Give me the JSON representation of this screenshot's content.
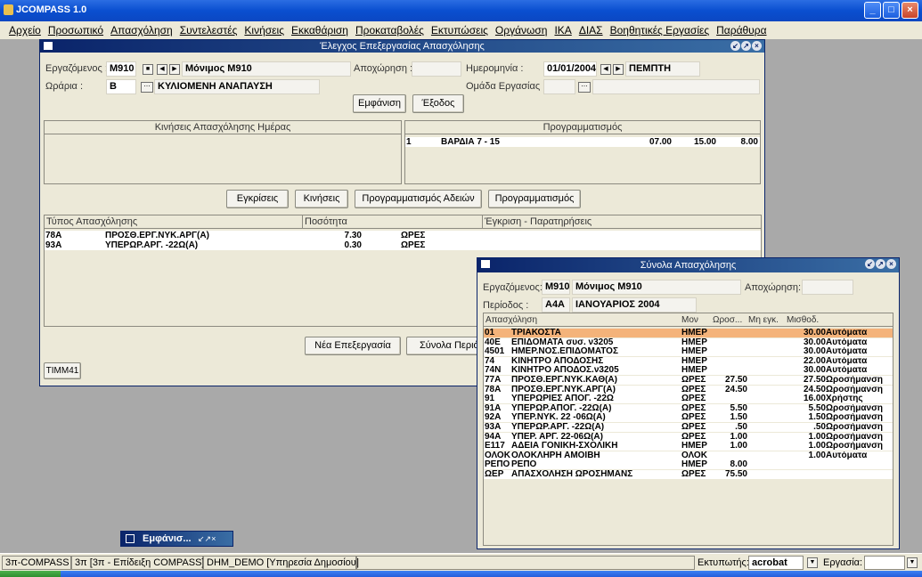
{
  "app": {
    "title": "JCOMPASS 1.0"
  },
  "window_controls": {
    "minimize": "_",
    "maximize": "□",
    "close": "×"
  },
  "menu": [
    "Αρχείο",
    "Προσωπικό",
    "Απασχόληση",
    "Συντελεστές",
    "Κινήσεις",
    "Εκκαθάριση",
    "Προκαταβολές",
    "Εκτυπώσεις",
    "Οργάνωση",
    "ΙΚΑ",
    "ΔΙΑΣ",
    "Βοηθητικές Εργασίες",
    "Παράθυρα"
  ],
  "main_window": {
    "title": "Έλεγχος Επεξεργασίας Απασχόλησης",
    "employee_label": "Εργαζόμενος :",
    "employee_code": "M910",
    "employee_name": "Μόνιμος Μ910",
    "leave_label": "Αποχώρηση :",
    "leave_value": "",
    "date_label": "Ημερομηνία :",
    "date_value": "01/01/2004",
    "day_name": "ΠΕΜΠΤΗ",
    "schedule_label": "Ωράρια :",
    "schedule_code": "B",
    "schedule_name": "ΚΥΛΙΟΜΕΝΗ ΑΝΑΠΑΥΣΗ",
    "workgroup_label": "Ομάδα Εργασίας :",
    "show_button": "Εμφάνιση",
    "exit_button": "Έξοδος",
    "movements_header": "Κινήσεις Απασχόλησης Ημέρας",
    "planning_header": "Προγραμματισμός",
    "planning_rows": [
      {
        "num": "1",
        "name": "ΒΑΡΔΙΑ 7 - 15",
        "from": "07.00",
        "to": "15.00",
        "hours": "8.00"
      }
    ],
    "approvals_button": "Εγκρίσεις",
    "movements_button": "Κινήσεις",
    "leave_planning_button": "Προγραμματισμός Αδειών",
    "planning_button": "Προγραμματισμός",
    "type_header": "Τύπος Απασχόλησης",
    "qty_header": "Ποσότητα",
    "approval_header": "Έγκριση - Παρατηρήσεις",
    "type_rows": [
      {
        "code": "78A",
        "name": "ΠΡΟΣΘ.ΕΡΓ.ΝΥΚ.ΑΡΓ(Α)",
        "qty": "7.30",
        "unit": "ΩΡΕΣ"
      },
      {
        "code": "93A",
        "name": "ΥΠΕΡΩΡ.ΑΡΓ. -22Ω(Α)",
        "qty": "0.30",
        "unit": "ΩΡΕΣ"
      }
    ],
    "new_processing_button": "Νέα Επεξεργασία",
    "totals_button": "Σύνολα Περιόδου",
    "tab_label": "TIMM41"
  },
  "totals_window": {
    "title": "Σύνολα Απασχόλησης",
    "employee_label": "Εργαζόμενος:",
    "employee_code": "M910",
    "employee_name": "Μόνιμος Μ910",
    "leave_label": "Αποχώρηση:",
    "period_label": "Περίοδος :",
    "period_code": "A4A",
    "period_name": "ΙΑΝΟΥΑΡΙΟΣ 2004",
    "headers": [
      "Απασχόληση",
      "Μον",
      "Ωροσ...",
      "Μη εγκ.",
      "Μισθοδ."
    ],
    "rows": [
      [
        "01",
        "ΤΡΙΑΚΟΣΤΑ",
        "ΗΜΕΡ",
        "",
        "",
        "30.00",
        "Αυτόματα"
      ],
      [
        "40E",
        "ΕΠΙΔΟΜΑΤΑ συσ. ν3205",
        "ΗΜΕΡ",
        "",
        "",
        "30.00",
        "Αυτόματα"
      ],
      [
        "4501",
        "ΗΜΕΡ.ΝΟΣ.ΕΠΙΔΟΜΑΤΟΣ",
        "ΗΜΕΡ",
        "",
        "",
        "30.00",
        "Αυτόματα"
      ],
      [
        "74",
        "ΚΙΝΗΤΡΟ ΑΠΟΔΟΣΗΣ",
        "ΗΜΕΡ",
        "",
        "",
        "22.00",
        "Αυτόματα"
      ],
      [
        "74N",
        "ΚΙΝΗΤΡΟ ΑΠΟΔΟΣ.ν3205",
        "ΗΜΕΡ",
        "",
        "",
        "30.00",
        "Αυτόματα"
      ],
      [
        "77A",
        "ΠΡΟΣΘ.ΕΡΓ.ΝΥΚ.ΚΑΘ(Α)",
        "ΩΡΕΣ",
        "27.50",
        "",
        "27.50",
        "Ωροσήμανση"
      ],
      [
        "78A",
        "ΠΡΟΣΘ.ΕΡΓ.ΝΥΚ.ΑΡΓ(Α)",
        "ΩΡΕΣ",
        "24.50",
        "",
        "24.50",
        "Ωροσήμανση"
      ],
      [
        "91",
        "ΥΠΕΡΩΡΙΕΣ ΑΠΟΓ. -22Ω",
        "ΩΡΕΣ",
        "",
        "",
        "16.00",
        "Χρήστης"
      ],
      [
        "91A",
        "ΥΠΕΡΩΡ.ΑΠΟΓ. -22Ω(Α)",
        "ΩΡΕΣ",
        "5.50",
        "",
        "5.50",
        "Ωροσήμανση"
      ],
      [
        "92A",
        "ΥΠΕΡ.ΝΥΚ. 22 -06Ω(Α)",
        "ΩΡΕΣ",
        "1.50",
        "",
        "1.50",
        "Ωροσήμανση"
      ],
      [
        "93A",
        "ΥΠΕΡΩΡ.ΑΡΓ. -22Ω(Α)",
        "ΩΡΕΣ",
        ".50",
        "",
        ".50",
        "Ωροσήμανση"
      ],
      [
        "94A",
        "ΥΠΕΡ. ΑΡΓ. 22-06Ω(Α)",
        "ΩΡΕΣ",
        "1.00",
        "",
        "1.00",
        "Ωροσήμανση"
      ],
      [
        "E117",
        "ΑΔΕΙΑ ΓΟΝΙΚΗ-ΣΧΟΛΙΚΗ",
        "ΗΜΕΡ",
        "1.00",
        "",
        "1.00",
        "Ωροσήμανση"
      ],
      [
        "ΟΛΟΚ",
        "ΟΛΟΚΛΗΡΗ ΑΜΟΙΒΗ",
        "ΟΛΟΚ",
        "",
        "",
        "1.00",
        "Αυτόματα"
      ],
      [
        "ΡΕΠΟ",
        "ΡΕΠΟ",
        "ΗΜΕΡ",
        "8.00",
        "",
        "",
        ""
      ],
      [
        "ΩΕΡ",
        "ΑΠΑΣΧΟΛΗΣΗ ΩΡΟΣΗΜΑΝΣ",
        "ΩΡΕΣ",
        "75.50",
        "",
        "",
        ""
      ]
    ]
  },
  "minimized_window": {
    "title": "Εμφάνισ..."
  },
  "statusbar": {
    "app": "3π-COMPASS",
    "company": "3π [3π - Επίδειξη COMPASS]",
    "db": "DHM_DEMO [Υπηρεσία Δημοσίου]",
    "printer_label": "Εκτυπωτής:",
    "printer_value": "acrobat",
    "work_label": "Εργασία:"
  },
  "colors": {
    "selected_row": "#f4b37a",
    "title_bar": "#0a246a",
    "xp_blue": "#0a4fd0"
  }
}
